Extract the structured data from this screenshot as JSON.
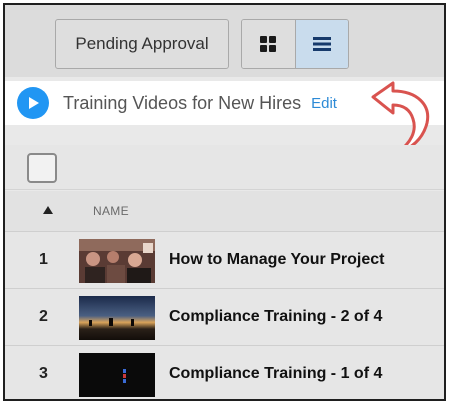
{
  "toolbar": {
    "pending_label": "Pending Approval",
    "grid_icon": "grid-icon",
    "list_icon": "list-icon"
  },
  "playlist": {
    "title": "Training Videos for New Hires",
    "edit_label": "Edit",
    "play_icon": "play-icon",
    "accent_color": "#2196f3"
  },
  "table": {
    "columns": [
      "NAME"
    ],
    "rows": [
      {
        "index": "1",
        "title": "How to Manage Your Project"
      },
      {
        "index": "2",
        "title": "Compliance Training - 2 of 4"
      },
      {
        "index": "3",
        "title": "Compliance Training - 1 of 4"
      }
    ]
  }
}
